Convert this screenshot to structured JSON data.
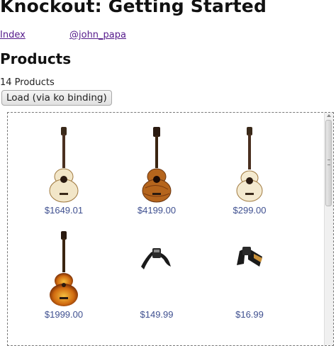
{
  "page": {
    "title": "Knockout: Getting Started",
    "nav": [
      {
        "label": "Index"
      },
      {
        "label": "@john_papa"
      }
    ],
    "section_title": "Products",
    "product_count": "14 Products",
    "load_button_label": "Load (via ko binding)"
  },
  "products": [
    {
      "price": "$1649.01",
      "image": "acoustic-guitar-natural"
    },
    {
      "price": "$4199.00",
      "image": "twelve-string-guitar-koa"
    },
    {
      "price": "$299.00",
      "image": "mini-acoustic-guitar"
    },
    {
      "price": "$1999.00",
      "image": "sunburst-guitar"
    },
    {
      "price": "$149.99",
      "image": "black-guitar-strap"
    },
    {
      "price": "$16.99",
      "image": "leather-guitar-strap"
    }
  ],
  "colors": {
    "price_text": "#3f5090",
    "link": "#551a8b"
  }
}
